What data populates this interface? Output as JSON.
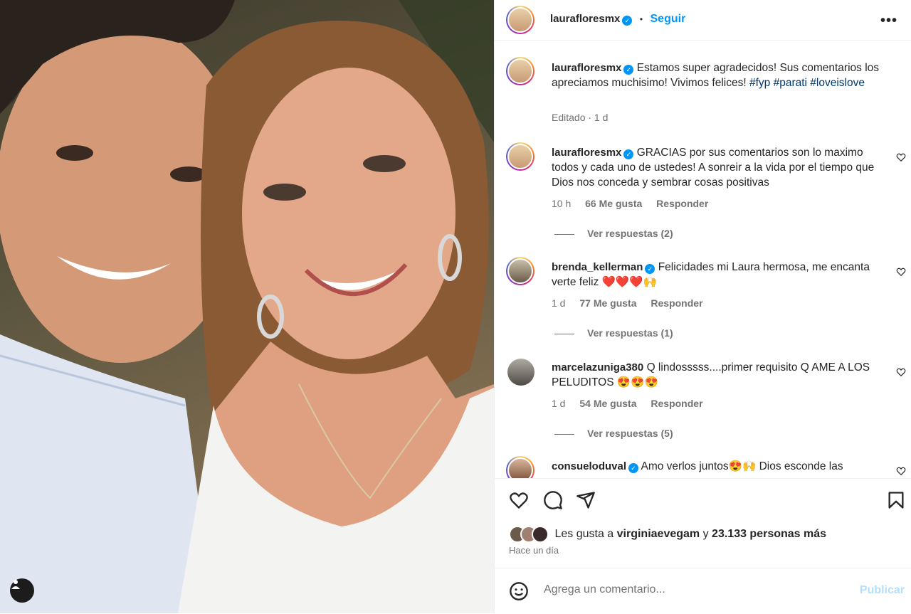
{
  "post": {
    "author": "laurafloresmx",
    "follow_label": "Seguir",
    "separator": "•",
    "more_icon": "more-horizontal-icon"
  },
  "caption": {
    "username": "laurafloresmx",
    "text": "Estamos super agradecidos! Sus comentarios los apreciamos muchisimo! Vivimos felices!",
    "hashtags": [
      "#fyp",
      "#parati",
      "#loveislove"
    ],
    "meta": "Editado · 1 d"
  },
  "comments": [
    {
      "username": "laurafloresmx",
      "text": "GRACIAS por sus comentarios son lo maximo todos y cada uno de ustedes! A sonreir a la vida por el tiempo que Dios nos conceda y sembrar cosas positivas",
      "time": "10 h",
      "likes": "66 Me gusta",
      "reply_label": "Responder",
      "view_replies": "Ver respuestas (2)"
    },
    {
      "username": "brenda_kellerman",
      "text": "Felicidades mi Laura hermosa, me encanta verte feliz ❤️❤️❤️🙌",
      "time": "1 d",
      "likes": "77 Me gusta",
      "reply_label": "Responder",
      "view_replies": "Ver respuestas (1)"
    },
    {
      "username": "marcelazuniga380",
      "text": "Q lindosssss....primer requisito Q AME A LOS PELUDITOS 😍😍😍",
      "time": "1 d",
      "likes": "54 Me gusta",
      "reply_label": "Responder",
      "view_replies": "Ver respuestas (5)"
    },
    {
      "username": "consueloduval",
      "text": "Amo verlos juntos😍🙌 Dios esconde las"
    }
  ],
  "actions": {
    "likes_prefix": "Les gusta a",
    "likes_user": "virginiaevegam",
    "likes_conj": "y",
    "likes_count": "23.133 personas más",
    "date": "Hace un día"
  },
  "composer": {
    "placeholder": "Agrega un comentario...",
    "publish_label": "Publicar"
  },
  "colors": {
    "accent": "#0095f6",
    "hashtag": "#00376b",
    "muted": "#737373"
  }
}
